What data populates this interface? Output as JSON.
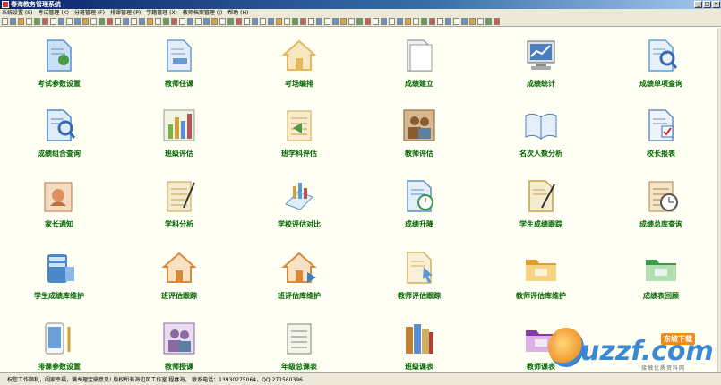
{
  "window": {
    "title": "春海教务管理系统",
    "buttons": [
      "_",
      "□",
      "×"
    ]
  },
  "menu": [
    "系统设置 (S)",
    "考试管理 (K)",
    "分班管理 (F)",
    "排课管理 (P)",
    "学籍管理 (X)",
    "教师档案管理 (J)",
    "帮助 (H)"
  ],
  "tiles": [
    {
      "label": "考试参数设置",
      "icon": "settings-doc-icon"
    },
    {
      "label": "教师任课",
      "icon": "teacher-doc-icon"
    },
    {
      "label": "考场编排",
      "icon": "house-calendar-icon"
    },
    {
      "label": "成绩建立",
      "icon": "document-stack-icon"
    },
    {
      "label": "成绩统计",
      "icon": "monitor-chart-icon"
    },
    {
      "label": "成绩单项查询",
      "icon": "magnifier-doc-icon"
    },
    {
      "label": "成绩组合查询",
      "icon": "search-doc-icon"
    },
    {
      "label": "班级评估",
      "icon": "bar-chart-icon"
    },
    {
      "label": "班学科评估",
      "icon": "calendar-arrow-icon"
    },
    {
      "label": "教师评估",
      "icon": "people-photo-icon"
    },
    {
      "label": "名次人数分析",
      "icon": "open-book-icon"
    },
    {
      "label": "校长报表",
      "icon": "checked-doc-icon"
    },
    {
      "label": "家长通知",
      "icon": "letter-icon"
    },
    {
      "label": "学科分析",
      "icon": "calendar-pen-icon"
    },
    {
      "label": "学校评估对比",
      "icon": "compare-chart-icon"
    },
    {
      "label": "成绩升降",
      "icon": "doc-clock-icon"
    },
    {
      "label": "学生成绩跟踪",
      "icon": "doc-pen-icon"
    },
    {
      "label": "成绩总库查询",
      "icon": "calendar-clock-icon"
    },
    {
      "label": "学生成绩库维护",
      "icon": "server-icon"
    },
    {
      "label": "班评估跟踪",
      "icon": "house-icon"
    },
    {
      "label": "班评估库维护",
      "icon": "house-arrow-icon"
    },
    {
      "label": "教师评估跟踪",
      "icon": "doc-cursor-icon"
    },
    {
      "label": "教师评估库维护",
      "icon": "folder-icon"
    },
    {
      "label": "成绩表回顾",
      "icon": "green-tray-icon"
    },
    {
      "label": "排课参数设置",
      "icon": "device-pen-icon"
    },
    {
      "label": "教师授课",
      "icon": "person-star-icon"
    },
    {
      "label": "年级总课表",
      "icon": "notepad-icon"
    },
    {
      "label": "班级课表",
      "icon": "books-icon"
    },
    {
      "label": "教师课表",
      "icon": "purple-tray-icon"
    }
  ],
  "status": {
    "text": "祝您工作顺利，阖家幸福，满乡理宝鼎意见!  版权所有海边风工作室 程春海，  联系电话：13930275064，QQ:271560396"
  },
  "watermark": {
    "main": "uzzf.com",
    "badge": "东坡下载",
    "sub": "接触优质资料网"
  },
  "colors": {
    "label": "#006400",
    "background": "#fffff4",
    "titlebar": "#0a246a"
  }
}
